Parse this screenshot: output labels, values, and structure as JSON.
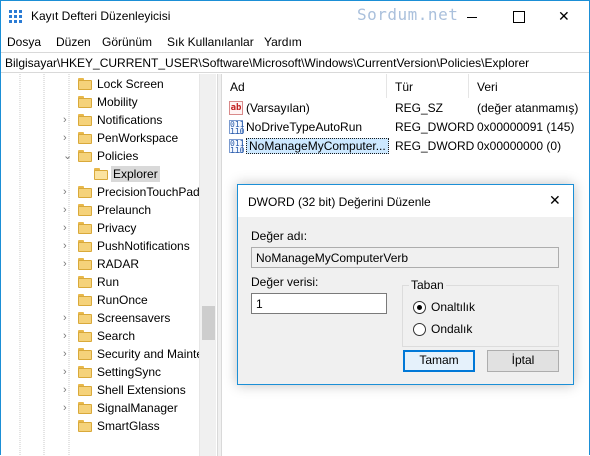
{
  "window": {
    "title": "Kayıt Defteri Düzenleyicisi",
    "watermark": "Sordum.net",
    "close_glyph": "✕"
  },
  "menu": {
    "items": [
      "Dosya",
      "Düzen",
      "Görünüm",
      "Sık Kullanılanlar",
      "Yardım"
    ]
  },
  "address": {
    "path": "Bilgisayar\\HKEY_CURRENT_USER\\Software\\Microsoft\\Windows\\CurrentVersion\\Policies\\Explorer"
  },
  "tree": {
    "items": [
      {
        "label": "Lock Screen",
        "expander": "",
        "level": 0
      },
      {
        "label": "Mobility",
        "expander": "",
        "level": 0
      },
      {
        "label": "Notifications",
        "expander": "›",
        "level": 0
      },
      {
        "label": "PenWorkspace",
        "expander": "›",
        "level": 0
      },
      {
        "label": "Policies",
        "expander": "⌄",
        "level": 0
      },
      {
        "label": "Explorer",
        "expander": "",
        "level": 1,
        "selected": true
      },
      {
        "label": "PrecisionTouchPad",
        "expander": "›",
        "level": 0
      },
      {
        "label": "Prelaunch",
        "expander": "›",
        "level": 0
      },
      {
        "label": "Privacy",
        "expander": "›",
        "level": 0
      },
      {
        "label": "PushNotifications",
        "expander": "›",
        "level": 0
      },
      {
        "label": "RADAR",
        "expander": "›",
        "level": 0
      },
      {
        "label": "Run",
        "expander": "",
        "level": 0
      },
      {
        "label": "RunOnce",
        "expander": "",
        "level": 0
      },
      {
        "label": "Screensavers",
        "expander": "›",
        "level": 0
      },
      {
        "label": "Search",
        "expander": "›",
        "level": 0
      },
      {
        "label": "Security and Mainte",
        "expander": "›",
        "level": 0
      },
      {
        "label": "SettingSync",
        "expander": "›",
        "level": 0
      },
      {
        "label": "Shell Extensions",
        "expander": "›",
        "level": 0
      },
      {
        "label": "SignalManager",
        "expander": "›",
        "level": 0
      },
      {
        "label": "SmartGlass",
        "expander": "",
        "level": 0
      }
    ]
  },
  "list": {
    "columns": [
      "Ad",
      "Tür",
      "Veri"
    ],
    "rows": [
      {
        "icon": "string-value-icon",
        "icon_text": "ab",
        "name": "(Varsayılan)",
        "type": "REG_SZ",
        "data": "(değer atanmamış)"
      },
      {
        "icon": "binary-value-icon",
        "icon_text": "011\n110",
        "name": "NoDriveTypeAutoRun",
        "type": "REG_DWORD",
        "data": "0x00000091 (145)"
      },
      {
        "icon": "binary-value-icon",
        "icon_text": "011\n110",
        "name": "NoManageMyComputer...",
        "type": "REG_DWORD",
        "data": "0x00000000 (0)",
        "selected": true
      }
    ]
  },
  "dialog": {
    "title": "DWORD (32 bit) Değerini Düzenle",
    "close_glyph": "✕",
    "value_name_label": "Değer adı:",
    "value_name": "NoManageMyComputerVerb",
    "value_data_label": "Değer verisi:",
    "value_data": "1",
    "base_group_label": "Taban",
    "base_options": [
      {
        "label": "Onaltılık",
        "checked": true
      },
      {
        "label": "Ondalık",
        "checked": false
      }
    ],
    "ok_label": "Tamam",
    "cancel_label": "İptal"
  },
  "colors": {
    "accent": "#0078d7",
    "selection": "#cce8ff",
    "folder": "#f5d27a"
  }
}
